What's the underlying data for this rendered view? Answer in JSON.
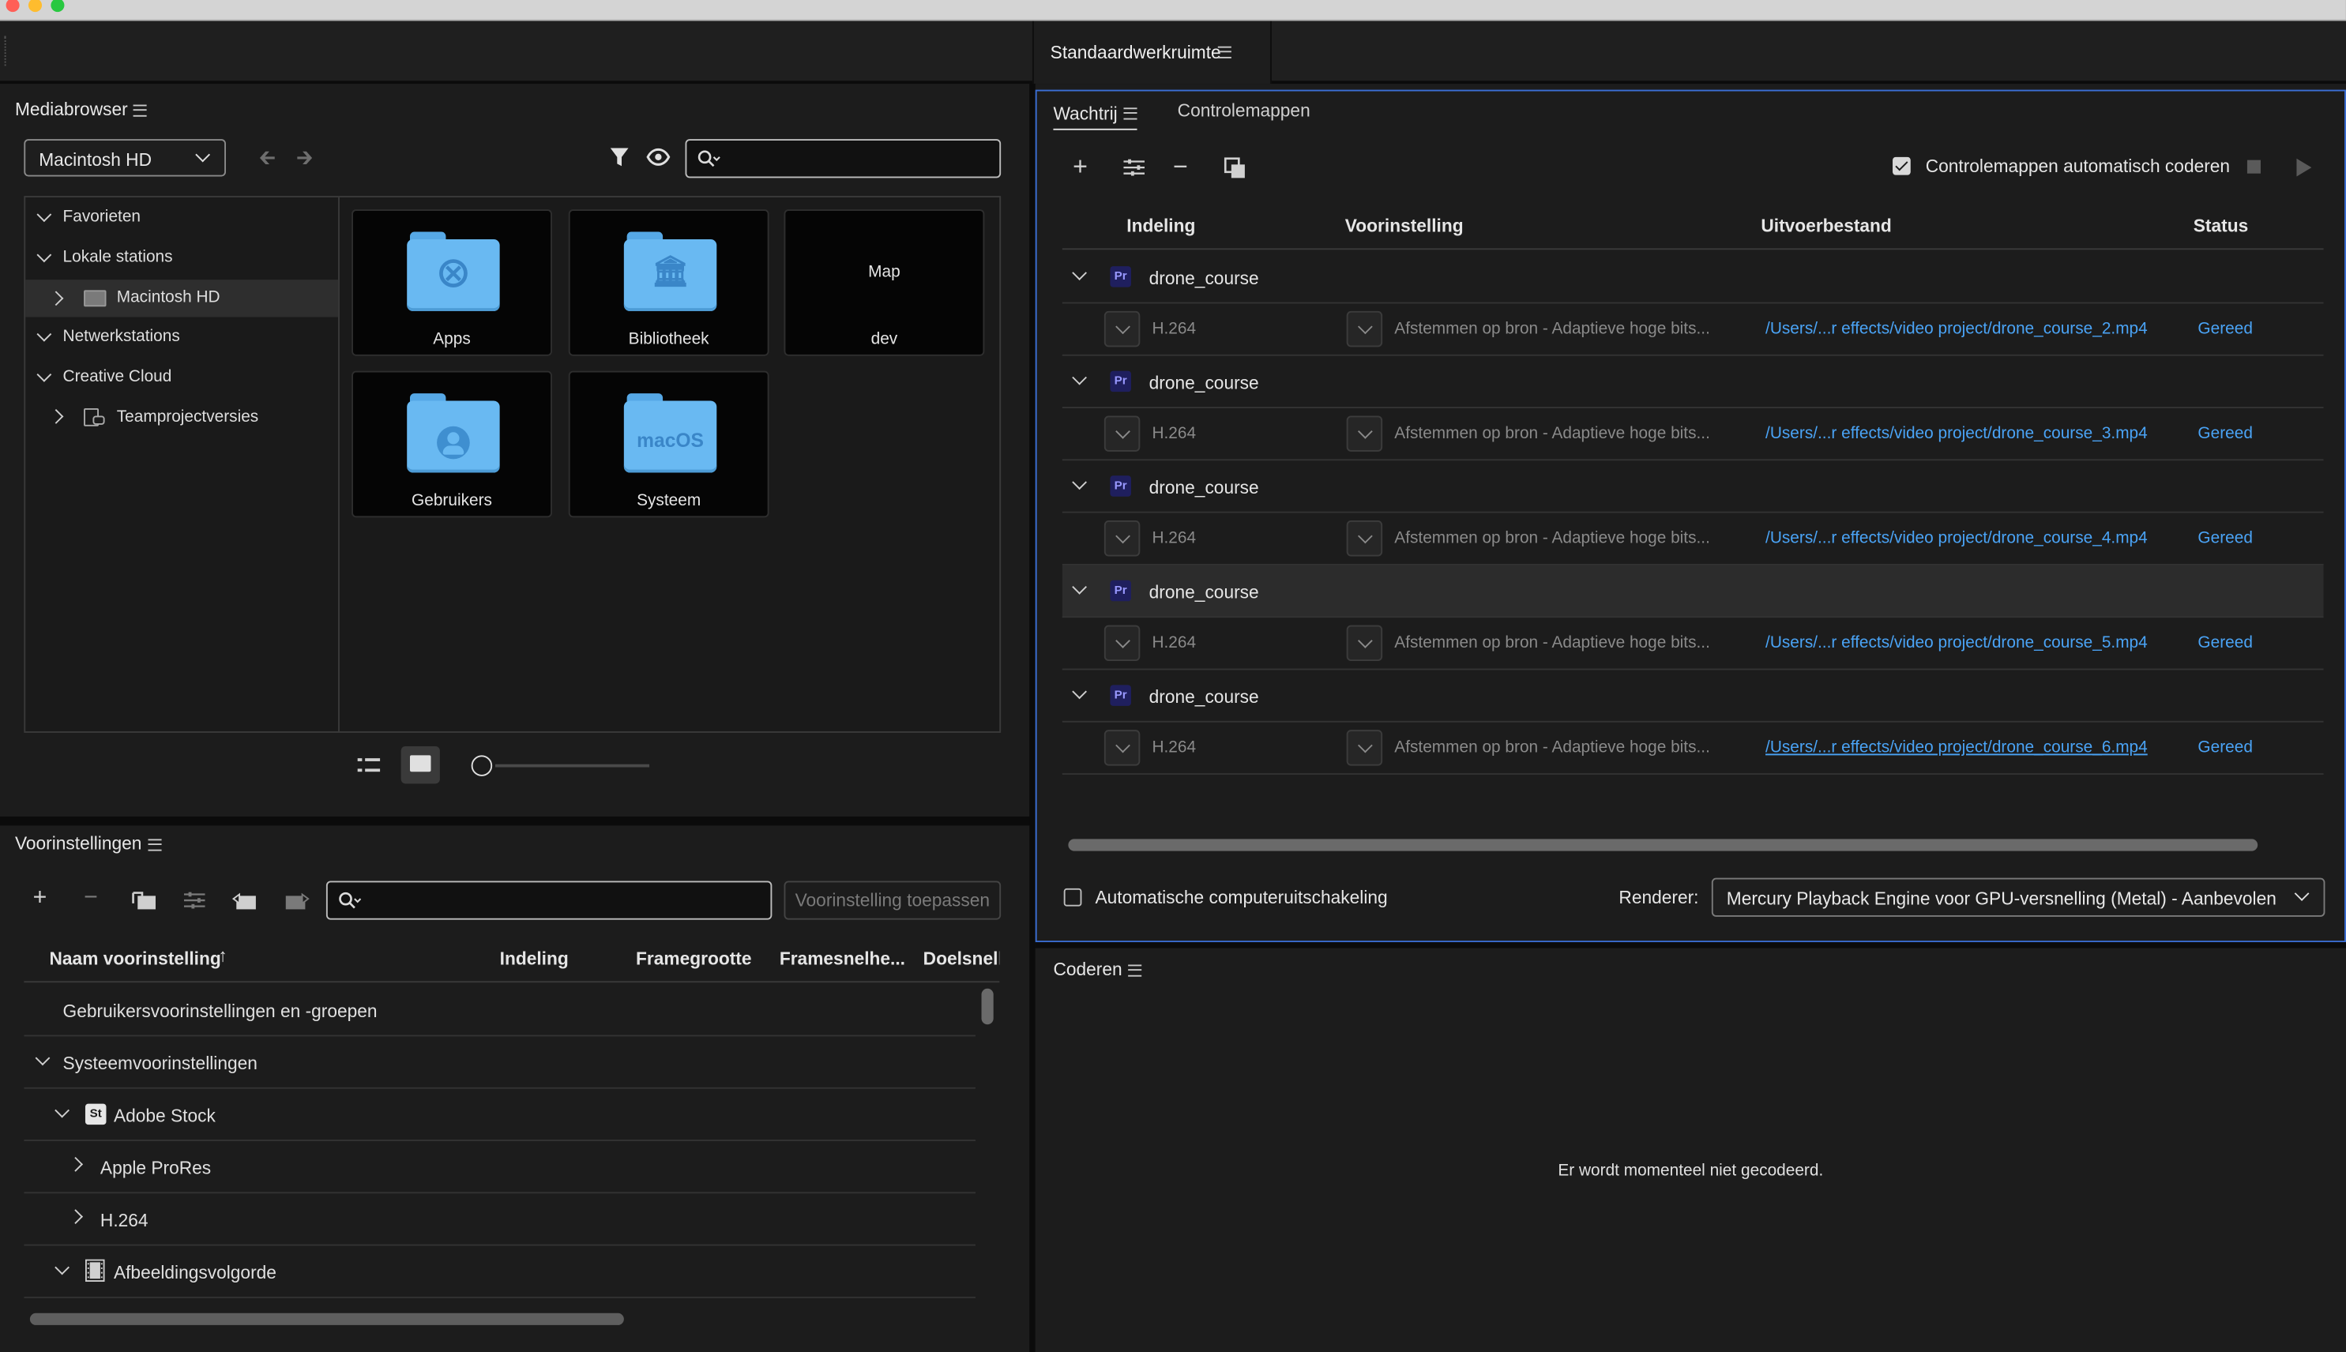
{
  "workspace": {
    "title": "Standaardwerkruimte"
  },
  "media_browser": {
    "title": "Mediabrowser",
    "location": "Macintosh HD",
    "search_placeholder": "",
    "tree": [
      {
        "label": "Favorieten",
        "expanded": true
      },
      {
        "label": "Lokale stations",
        "expanded": true
      },
      {
        "label": "Macintosh HD",
        "selected": true
      },
      {
        "label": "Netwerkstations",
        "expanded": true
      },
      {
        "label": "Creative Cloud",
        "expanded": true
      },
      {
        "label": "Teamprojectversies"
      }
    ],
    "tiles": [
      {
        "label": "Apps",
        "icon": "apps-folder-icon"
      },
      {
        "label": "Bibliotheek",
        "icon": "library-folder-icon"
      },
      {
        "label": "dev",
        "overlay": "Map"
      },
      {
        "label": "Gebruikers",
        "icon": "users-folder-icon"
      },
      {
        "label": "Systeem",
        "icon": "macos-folder-icon",
        "glyph": "macOS"
      }
    ]
  },
  "presets": {
    "title": "Voorinstellingen",
    "search_placeholder": "",
    "apply_button": "Voorinstelling toepassen",
    "columns": [
      "Naam voorinstelling",
      "Indeling",
      "Framegrootte",
      "Framesnelhe...",
      "Doelsnelh"
    ],
    "rows": [
      {
        "label": "Gebruikersvoorinstellingen en -groepen"
      },
      {
        "label": "Systeemvoorinstellingen"
      },
      {
        "label": "Adobe Stock",
        "badge": "St"
      },
      {
        "label": "Apple ProRes"
      },
      {
        "label": "H.264"
      },
      {
        "label": "Afbeeldingsvolgorde"
      }
    ]
  },
  "queue": {
    "tabs": [
      "Wachtrij",
      "Controlemappen"
    ],
    "auto_encode_label": "Controlemappen automatisch coderen",
    "auto_encode_checked": true,
    "columns": {
      "format": "Indeling",
      "preset": "Voorinstelling",
      "output": "Uitvoerbestand",
      "status": "Status"
    },
    "items": [
      {
        "name": "drone_course",
        "format": "H.264",
        "preset": "Afstemmen op bron - Adaptieve hoge bits...",
        "output": "/Users/...r effects/video project/drone_course_2.mp4",
        "status": "Gereed"
      },
      {
        "name": "drone_course",
        "format": "H.264",
        "preset": "Afstemmen op bron - Adaptieve hoge bits...",
        "output": "/Users/...r effects/video project/drone_course_3.mp4",
        "status": "Gereed"
      },
      {
        "name": "drone_course",
        "format": "H.264",
        "preset": "Afstemmen op bron - Adaptieve hoge bits...",
        "output": "/Users/...r effects/video project/drone_course_4.mp4",
        "status": "Gereed"
      },
      {
        "name": "drone_course",
        "format": "H.264",
        "preset": "Afstemmen op bron - Adaptieve hoge bits...",
        "output": "/Users/...r effects/video project/drone_course_5.mp4",
        "status": "Gereed"
      },
      {
        "name": "drone_course",
        "format": "H.264",
        "preset": "Afstemmen op bron - Adaptieve hoge bits...",
        "output": "/Users/...r effects/video project/drone_course_6.mp4",
        "status": "Gereed"
      }
    ],
    "auto_shutdown_label": "Automatische computeruitschakeling",
    "auto_shutdown_checked": false,
    "renderer_label": "Renderer:",
    "renderer_value": "Mercury Playback Engine voor GPU-versnelling (Metal) - Aanbevolen"
  },
  "encoding": {
    "title": "Coderen",
    "message": "Er wordt momenteel niet gecodeerd."
  },
  "colors": {
    "accent": "#4aa3f5",
    "panel_focus": "#3b6fd6",
    "background": "#1c1c1c"
  }
}
